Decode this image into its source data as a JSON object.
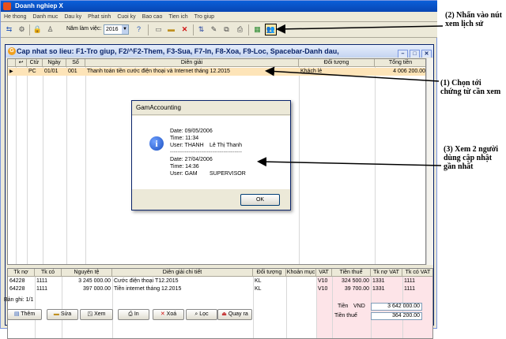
{
  "window": {
    "title": "Doanh nghiep X"
  },
  "menu": [
    "He thong",
    "Danh muc",
    "Dau ky",
    "Phat sinh",
    "Cuoi ky",
    "Bao cao",
    "Tien ich",
    "Tro giup"
  ],
  "toolbar": {
    "year_label": "Năm làm việc:",
    "year_value": "2016"
  },
  "child": {
    "title": "Cap nhat so lieu: F1-Tro giup, F2/^F2-Them, F3-Sua, F7-In, F8-Xoa, F9-Loc, Spacebar-Danh dau,"
  },
  "voucher_grid": {
    "headers": [
      "Ctừ",
      "Ngày",
      "Số",
      "Diễn giải",
      "Đối tượng",
      "Tổng tiền"
    ],
    "rows": [
      {
        "ct": "PC",
        "date": "01/01",
        "so": "001",
        "desc": "Thanh toán tiền cước điện thoại và Internet tháng 12.2015",
        "party": "Khách lẻ",
        "total": "4 006 200.00"
      }
    ]
  },
  "detail_grid": {
    "headers": [
      "Tk nợ",
      "Tk có",
      "Nguyên tệ",
      "Diễn giải chi tiết",
      "Đối tượng",
      "Khoản mục",
      "VAT",
      "Tiền thuế",
      "Tk nợ VAT",
      "Tk có VAT"
    ],
    "rows": [
      {
        "tkno": "64228",
        "tkco": "1111",
        "amount": "3 245 000.00",
        "desc": "Cước điện thoại T12.2015",
        "party": "KL",
        "vat": "V10",
        "tax": "324 500.00",
        "tknovat": "1331",
        "tkcovat": "1111"
      },
      {
        "tkno": "64228",
        "tkco": "1111",
        "amount": "397 000.00",
        "desc": "Tiền internet tháng 12.2015",
        "party": "KL",
        "vat": "V10",
        "tax": "39 700.00",
        "tknovat": "1331",
        "tkcovat": "1111"
      }
    ]
  },
  "status": {
    "records": "Bản ghi: 1/1"
  },
  "buttons": [
    "Thêm",
    "Sửa",
    "Xem",
    "In",
    "Xoá",
    "Lọc",
    "Quay ra"
  ],
  "totals": {
    "money_label": "Tiền",
    "currency": "VND",
    "money_value": "3 642 000.00",
    "tax_label": "Tiền thuế",
    "tax_value": "364 200.00"
  },
  "dialog": {
    "title": "GamAccounting",
    "lines": [
      "Date: 09/05/2006",
      "Time: 11:34",
      "User: THANH",
      "Lê Thị Thanh",
      "---------------------------------------",
      "Date: 27/04/2006",
      "Time: 14:36",
      "User: GAM",
      "SUPERVISOR"
    ],
    "ok": "OK"
  },
  "annotations": {
    "note2": "(2) Nhấn vào nút xem lịch sử",
    "note1": "(1) Chọn tới chứng từ cần xem",
    "note3": "(3) Xem 2 người dùng cập nhật gần nhất"
  }
}
